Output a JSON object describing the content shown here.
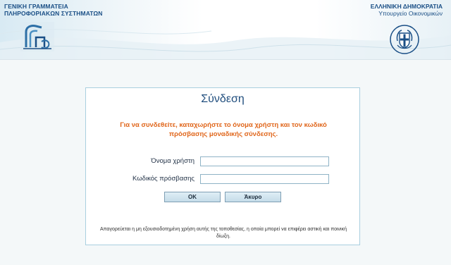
{
  "header": {
    "gsis_line1": "ΓΕΝΙΚΗ ΓΡΑΜΜΑΤΕΙΑ",
    "gsis_line2": "ΠΛΗΡΟΦΟΡΙΑΚΩΝ ΣΥΣΤΗΜΑΤΩΝ",
    "state_line1": "ΕΛΛΗΝΙΚΗ ΔΗΜΟΚΡΑΤΙΑ",
    "state_line2": "Υπουργείο Οικονομικών",
    "gsis_logo_icon": "gsis-logo-icon",
    "emblem_icon": "greek-coat-of-arms-icon"
  },
  "login": {
    "title": "Σύνδεση",
    "instructions": "Για να συνδεθείτε, καταχωρήστε το όνομα χρήστη και τον κωδικό πρόσβασης μοναδικής σύνδεσης.",
    "username_label": "Όνομα χρήστη",
    "username_value": "",
    "password_label": "Κωδικός πρόσβασης",
    "password_value": "",
    "ok_label": "OK",
    "cancel_label": "Άκυρο",
    "warning": "Απαγορεύεται η μη εξουσιοδοτημένη χρήση αυτής της τοποθεσίας, η οποία μπορεί να επιφέρει αστική και ποινική δίωξη."
  },
  "colors": {
    "title": "#1f4d7d",
    "instructions": "#e0661b",
    "box_border": "#a9cfdf",
    "background": "#f4f8f9"
  }
}
